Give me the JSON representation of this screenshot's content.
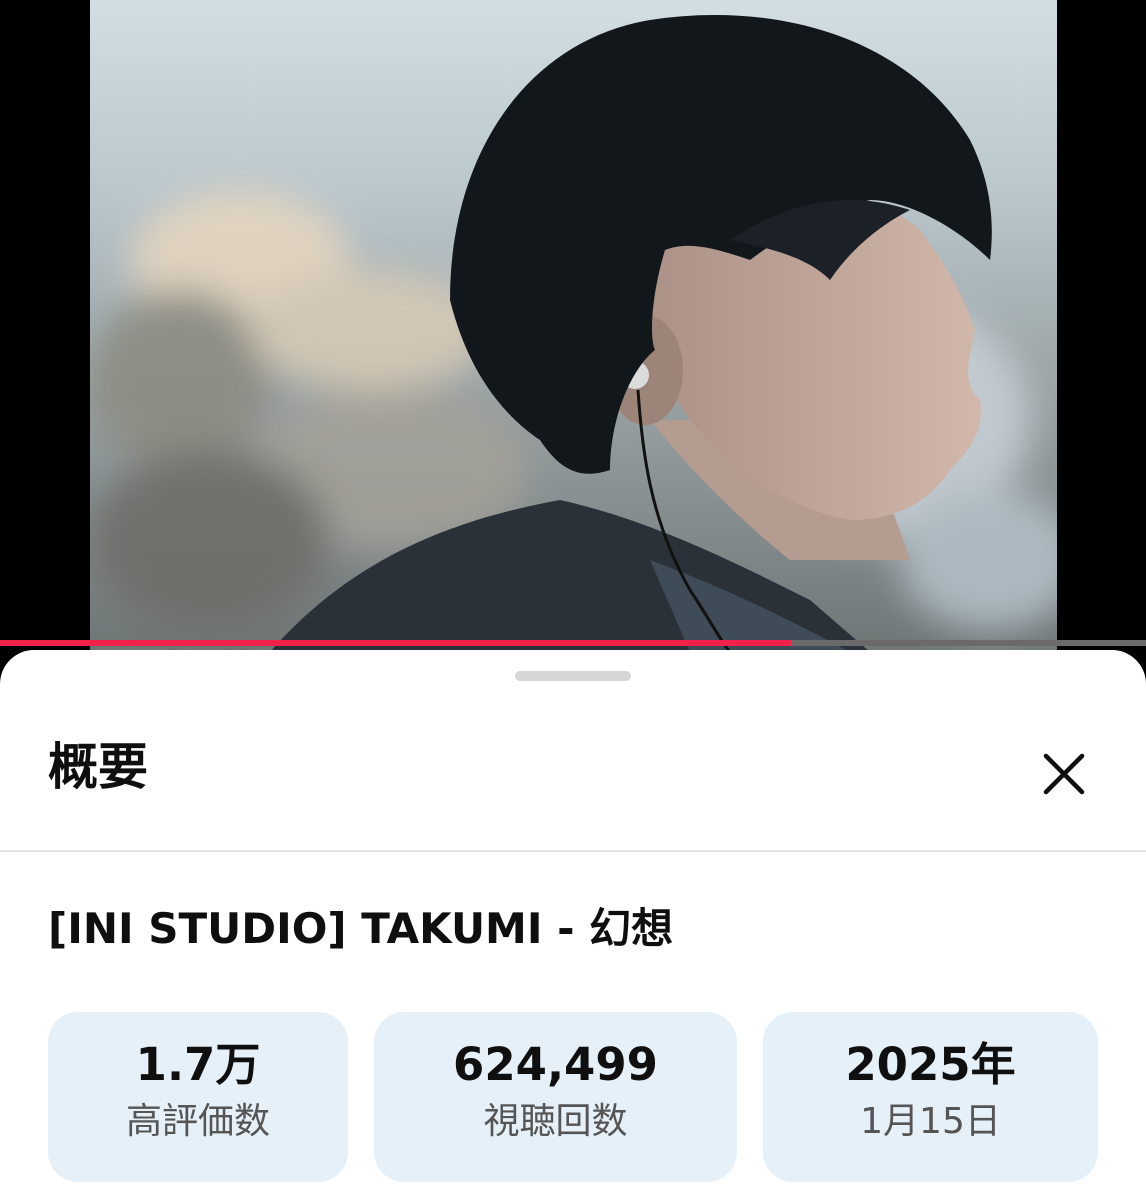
{
  "player": {
    "progress": 0.69
  },
  "sheet": {
    "title": "概要",
    "video_title": "[INI STUDIO] TAKUMI - 幻想",
    "close_icon": "close-icon"
  },
  "stats": [
    {
      "value": "1.7万",
      "label": "高評価数"
    },
    {
      "value": "624,499",
      "label": "視聴回数"
    },
    {
      "value": "2025年",
      "label": "1月15日"
    }
  ],
  "colors": {
    "progress": "#f0224a",
    "stat_background": "#e5f0f9"
  }
}
